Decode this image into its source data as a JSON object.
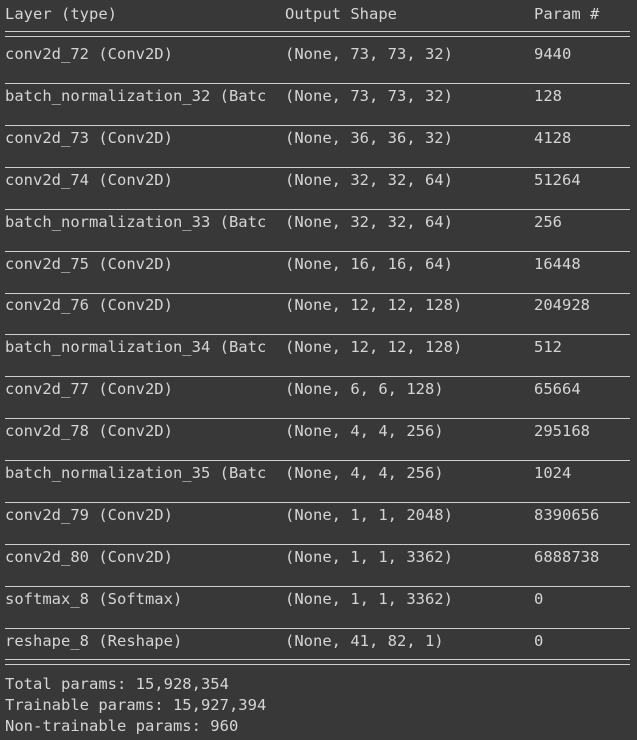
{
  "header": {
    "layer": "Layer (type)",
    "shape": "Output Shape",
    "params": "Param #"
  },
  "rows": [
    {
      "layer": "conv2d_72 (Conv2D)",
      "shape": "(None, 73, 73, 32)",
      "params": "9440"
    },
    {
      "layer": "batch_normalization_32 (Batc",
      "shape": "(None, 73, 73, 32)",
      "params": "128"
    },
    {
      "layer": "conv2d_73 (Conv2D)",
      "shape": "(None, 36, 36, 32)",
      "params": "4128"
    },
    {
      "layer": "conv2d_74 (Conv2D)",
      "shape": "(None, 32, 32, 64)",
      "params": "51264"
    },
    {
      "layer": "batch_normalization_33 (Batc",
      "shape": "(None, 32, 32, 64)",
      "params": "256"
    },
    {
      "layer": "conv2d_75 (Conv2D)",
      "shape": "(None, 16, 16, 64)",
      "params": "16448"
    },
    {
      "layer": "conv2d_76 (Conv2D)",
      "shape": "(None, 12, 12, 128)",
      "params": "204928"
    },
    {
      "layer": "batch_normalization_34 (Batc",
      "shape": "(None, 12, 12, 128)",
      "params": "512"
    },
    {
      "layer": "conv2d_77 (Conv2D)",
      "shape": "(None, 6, 6, 128)",
      "params": "65664"
    },
    {
      "layer": "conv2d_78 (Conv2D)",
      "shape": "(None, 4, 4, 256)",
      "params": "295168"
    },
    {
      "layer": "batch_normalization_35 (Batc",
      "shape": "(None, 4, 4, 256)",
      "params": "1024"
    },
    {
      "layer": "conv2d_79 (Conv2D)",
      "shape": "(None, 1, 1, 2048)",
      "params": "8390656"
    },
    {
      "layer": "conv2d_80 (Conv2D)",
      "shape": "(None, 1, 1, 3362)",
      "params": "6888738"
    },
    {
      "layer": "softmax_8 (Softmax)",
      "shape": "(None, 1, 1, 3362)",
      "params": "0"
    },
    {
      "layer": "reshape_8 (Reshape)",
      "shape": "(None, 41, 82, 1)",
      "params": "0"
    }
  ],
  "summary": {
    "total": "Total params: 15,928,354",
    "trainable": "Trainable params: 15,927,394",
    "non_trainable": "Non-trainable params: 960"
  },
  "colors": {
    "background": "#383838",
    "text": "#d5d5d5",
    "rule": "#cfcfcf"
  }
}
